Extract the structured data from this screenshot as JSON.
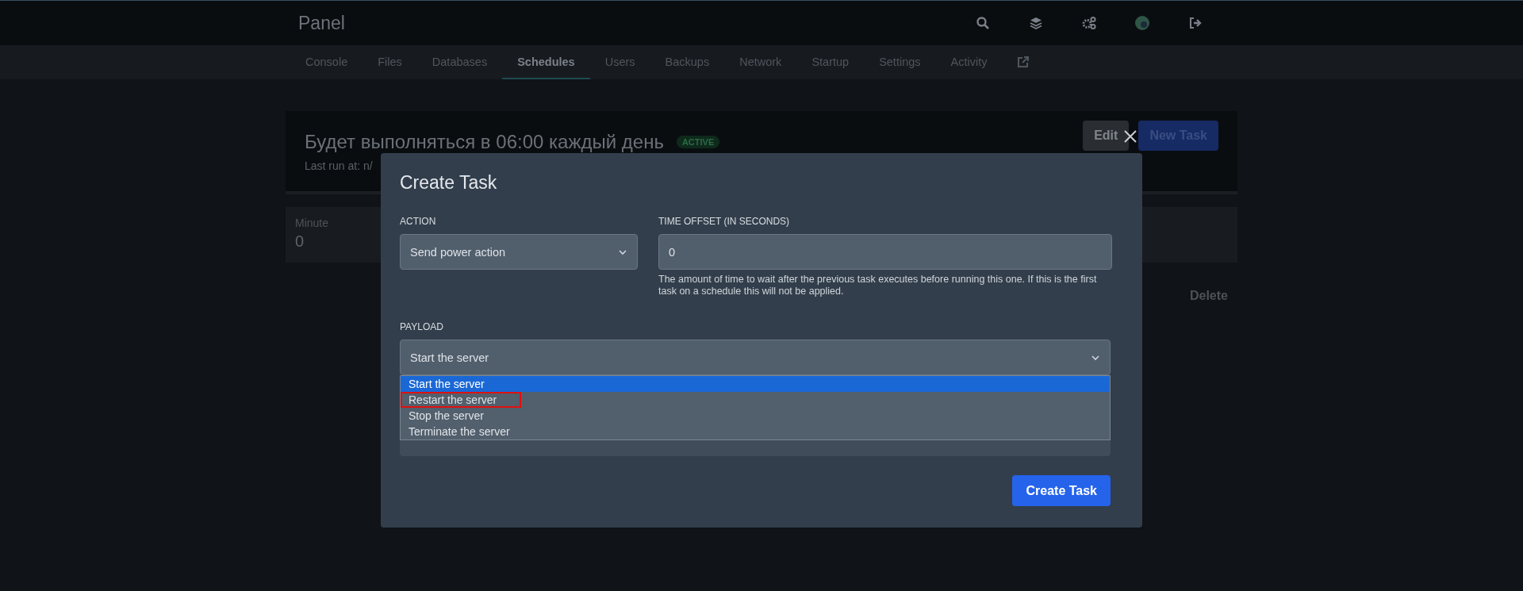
{
  "topbar": {
    "title": "Panel"
  },
  "nav": {
    "tabs": [
      {
        "label": "Console",
        "selected": false
      },
      {
        "label": "Files",
        "selected": false
      },
      {
        "label": "Databases",
        "selected": false
      },
      {
        "label": "Schedules",
        "selected": true
      },
      {
        "label": "Users",
        "selected": false
      },
      {
        "label": "Backups",
        "selected": false
      },
      {
        "label": "Network",
        "selected": false
      },
      {
        "label": "Startup",
        "selected": false
      },
      {
        "label": "Settings",
        "selected": false
      },
      {
        "label": "Activity",
        "selected": false
      }
    ]
  },
  "schedule": {
    "title": "Будет выполняться в 06:00 каждый день",
    "status": "ACTIVE",
    "last_run": "Last run at: n/",
    "buttons": [
      {
        "label": "Edit",
        "kind": "secondary"
      },
      {
        "label": "New Task",
        "kind": "primary"
      }
    ]
  },
  "cron": [
    {
      "label": "Minute",
      "value": "0"
    }
  ],
  "delete": "Delete",
  "modal": {
    "title": "Create Task",
    "action": {
      "label": "ACTION",
      "value": "Send power action"
    },
    "time_offset": {
      "label": "TIME OFFSET (IN SECONDS)",
      "value": "0",
      "help": "The amount of time to wait after the previous task executes before running this one. If this is the first task on a schedule this will not be applied."
    },
    "payload": {
      "label": "PAYLOAD",
      "value": "Start the server",
      "expanded": true,
      "options": [
        {
          "label": "Start the server",
          "selected": true,
          "outlined": false
        },
        {
          "label": "Restart the server",
          "selected": false,
          "outlined": true
        },
        {
          "label": "Stop the server",
          "selected": false,
          "outlined": false
        },
        {
          "label": "Terminate the server",
          "selected": false,
          "outlined": false
        }
      ]
    },
    "submit": "Create Task"
  }
}
